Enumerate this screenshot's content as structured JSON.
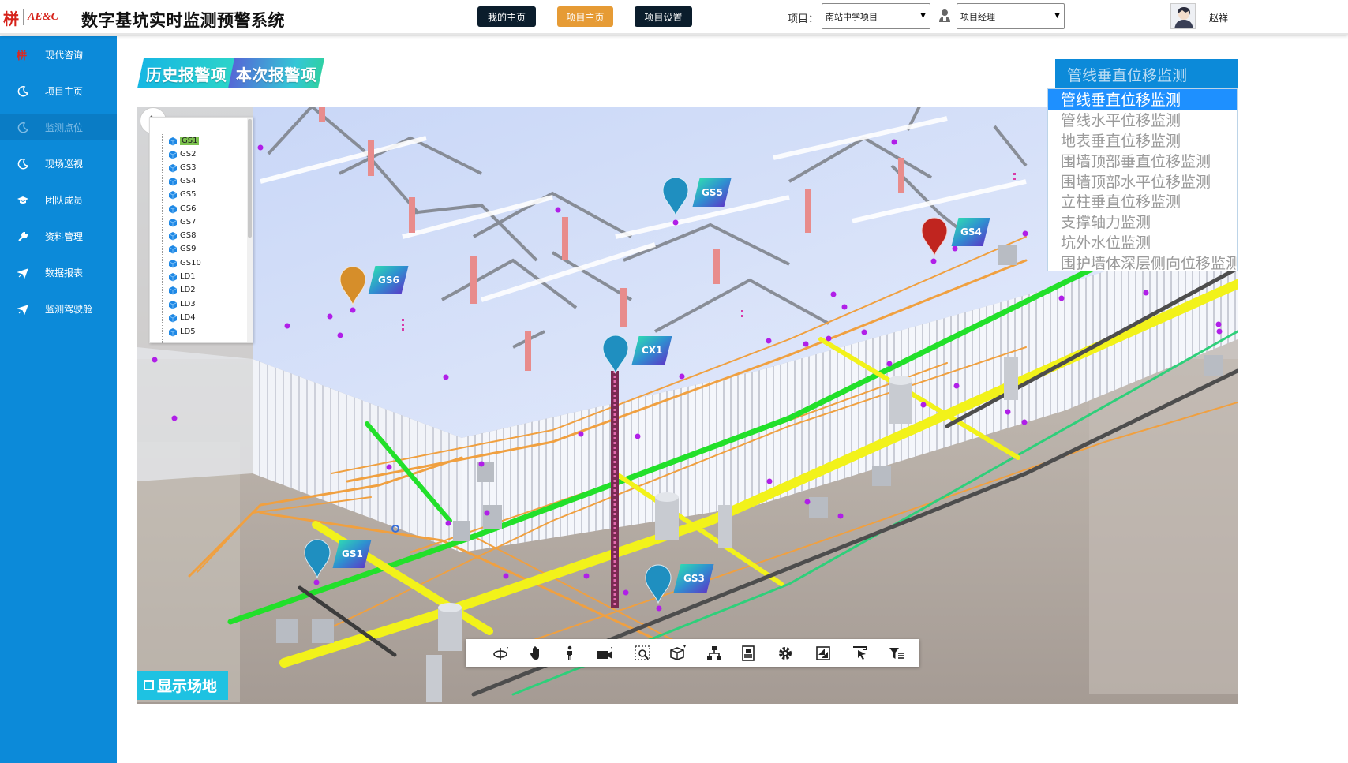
{
  "header": {
    "logo_mark": "栟",
    "logo_text": "AE&C",
    "app_title": "数字基坑实时监测预警系统",
    "nav_buttons": [
      "我的主页",
      "项目主页",
      "项目设置"
    ],
    "project_label": "项目：",
    "project_value": "南站中学项目",
    "role_value": "项目经理",
    "user_name": "赵祥"
  },
  "sidebar": {
    "items": [
      {
        "label": "现代咨询",
        "icon": "company-logo-icon"
      },
      {
        "label": "项目主页",
        "icon": "moon-icon"
      },
      {
        "label": "监测点位",
        "icon": "moon-icon",
        "active": true
      },
      {
        "label": "现场巡视",
        "icon": "moon-icon"
      },
      {
        "label": "团队成员",
        "icon": "graduation-cap-icon"
      },
      {
        "label": "资料管理",
        "icon": "wrench-icon"
      },
      {
        "label": "数据报表",
        "icon": "plane-icon"
      },
      {
        "label": "监测驾驶舱",
        "icon": "plane-icon"
      }
    ]
  },
  "tabs": {
    "history_alarm": "历史报警项",
    "current_alarm": "本次报警项"
  },
  "tree": {
    "nodes": [
      "GS1",
      "GS2",
      "GS3",
      "GS4",
      "GS5",
      "GS6",
      "GS7",
      "GS8",
      "GS9",
      "GS10",
      "LD1",
      "LD2",
      "LD3",
      "LD4",
      "LD5"
    ],
    "selected": "GS1"
  },
  "markers": [
    {
      "label": "GS5",
      "color": "#1f8fc0"
    },
    {
      "label": "GS4",
      "color": "#c0251f"
    },
    {
      "label": "GS6",
      "color": "#d68e2a"
    },
    {
      "label": "CX1",
      "color": "#1f8fc0"
    },
    {
      "label": "GS1",
      "color": "#1f8fc0"
    },
    {
      "label": "GS3",
      "color": "#1f8fc0"
    }
  ],
  "toolbar": {
    "tools": [
      "orbit-icon",
      "pan-hand-icon",
      "walk-person-icon",
      "camera-icon",
      "zoom-window-icon",
      "section-box-icon",
      "model-tree-icon",
      "properties-icon",
      "settings-gear-icon",
      "fullscreen-icon",
      "select-cursor-icon",
      "filter-icon"
    ]
  },
  "show_site_label": "显示场地",
  "monitor_type": {
    "selected": "管线垂直位移监测",
    "options": [
      "管线垂直位移监测",
      "管线水平位移监测",
      "地表垂直位移监测",
      "围墙顶部垂直位移监测",
      "围墙顶部水平位移监测",
      "立柱垂直位移监测",
      "支撑轴力监测",
      "坑外水位监测",
      "围护墙体深层侧向位移监测"
    ]
  },
  "colors": {
    "sidebar": "#0c8ad9",
    "tab_cyan": "#1ec2e2",
    "nav_dark": "#0b1d2c",
    "nav_orange": "#e69b35",
    "pipe_green": "#22e02a",
    "pipe_yellow": "#f2f21a",
    "pipe_orange": "#f0a040"
  }
}
